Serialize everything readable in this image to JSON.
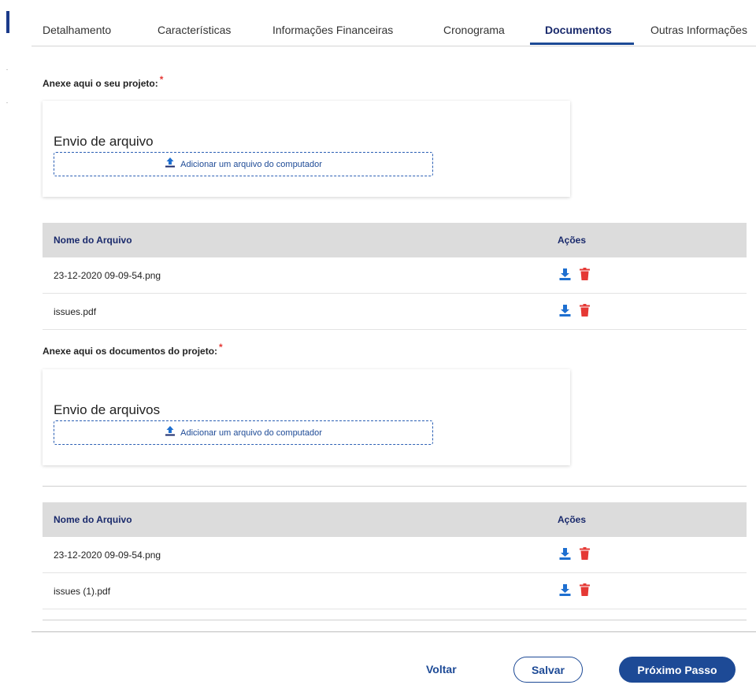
{
  "colors": {
    "accent": "#1d4a96",
    "danger": "#e53935",
    "download": "#1e6fd0",
    "header_bg": "#dcdcdc"
  },
  "tabs": [
    {
      "label": "Detalhamento"
    },
    {
      "label": "Características"
    },
    {
      "label": "Informações Financeiras"
    },
    {
      "label": "Cronograma"
    },
    {
      "label": "Documentos",
      "active": true
    },
    {
      "label": "Outras Informações"
    }
  ],
  "project_section": {
    "label": "Anexe aqui o seu projeto:",
    "required_mark": "*",
    "upload": {
      "title": "Envio de arquivo",
      "button_label": "Adicionar um arquivo do computador",
      "icon": "upload-icon"
    },
    "table": {
      "headers": [
        "Nome do Arquivo",
        "Ações"
      ],
      "rows": [
        {
          "name": "23-12-2020 09-09-54.png",
          "actions": [
            "download-icon",
            "trash-icon"
          ]
        },
        {
          "name": "issues.pdf",
          "actions": [
            "download-icon",
            "trash-icon"
          ]
        }
      ]
    }
  },
  "documents_section": {
    "label": "Anexe aqui os documentos do projeto:",
    "required_mark": "*",
    "upload": {
      "title": "Envio de arquivos",
      "button_label": "Adicionar um arquivo do computador",
      "icon": "upload-icon"
    },
    "table": {
      "headers": [
        "Nome do Arquivo",
        "Ações"
      ],
      "rows": [
        {
          "name": "23-12-2020 09-09-54.png",
          "actions": [
            "download-icon",
            "trash-icon"
          ]
        },
        {
          "name": "issues (1).pdf",
          "actions": [
            "download-icon",
            "trash-icon"
          ]
        }
      ]
    }
  },
  "footer": {
    "back_label": "Voltar",
    "save_label": "Salvar",
    "next_label": "Próximo Passo"
  }
}
